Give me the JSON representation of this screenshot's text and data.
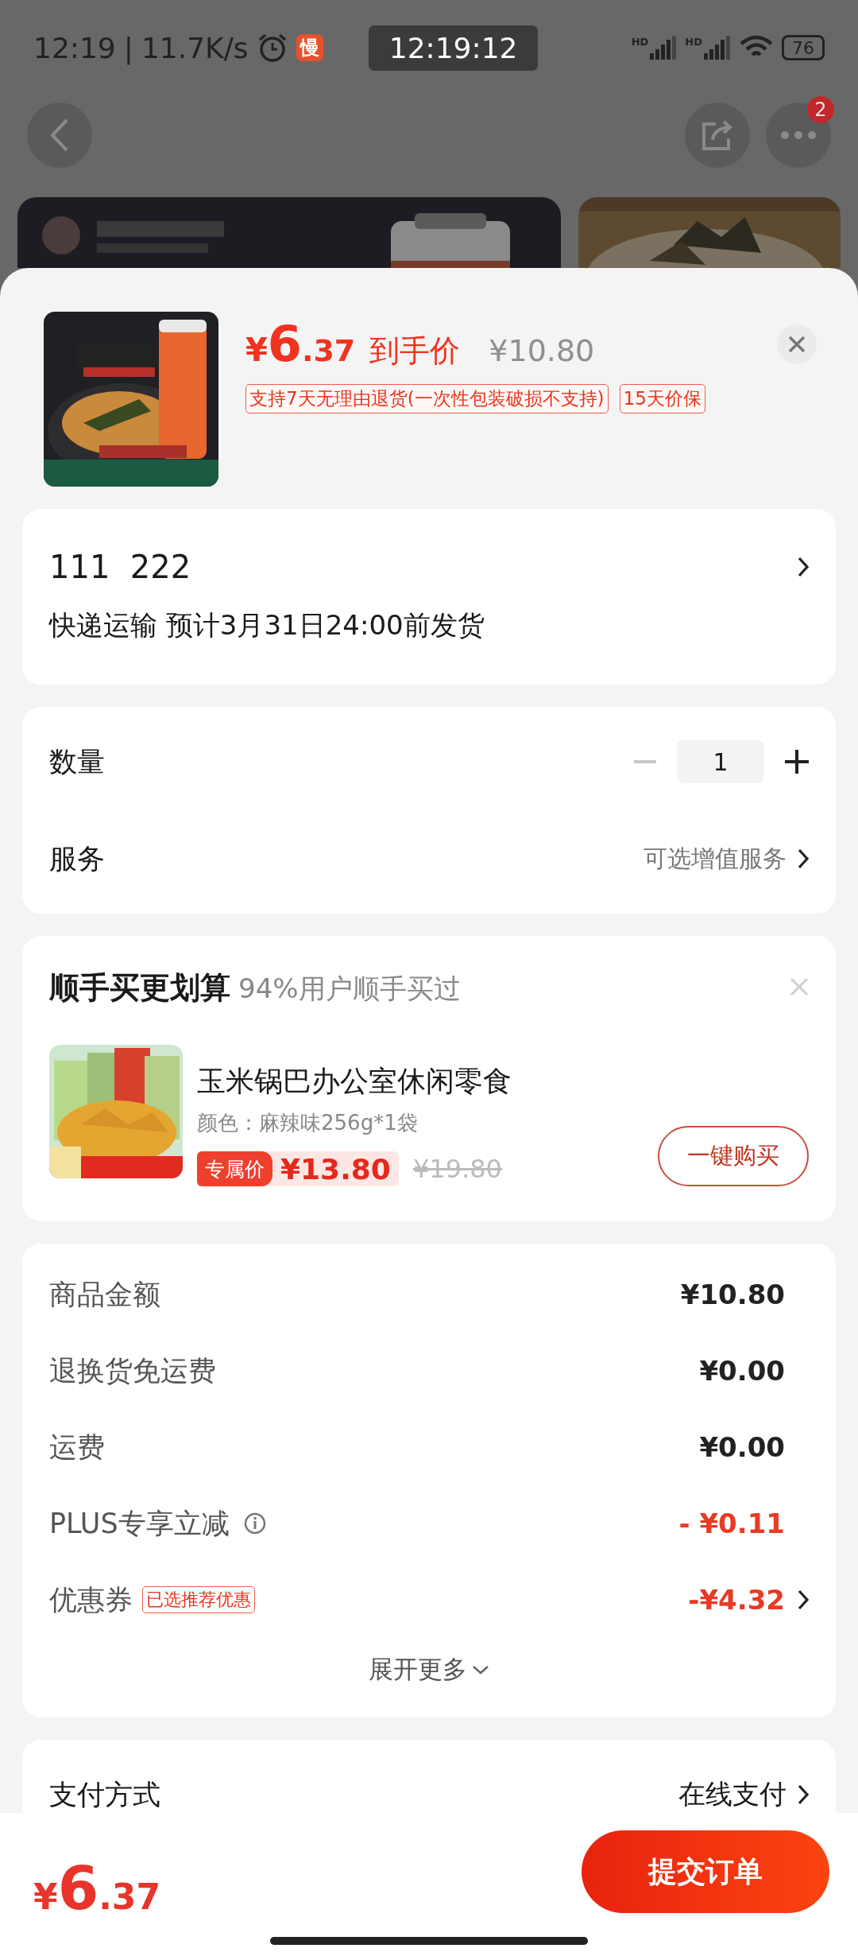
{
  "status_bar": {
    "time": "12:19",
    "separator": "|",
    "speed": "11.7K/s",
    "slow_badge": "慢",
    "clock_overlay": "12:19:12",
    "signals": [
      {
        "label": "HD"
      },
      {
        "label": "HD"
      }
    ],
    "battery": "76"
  },
  "nav": {
    "more_badge": "2"
  },
  "product": {
    "currency": "¥",
    "price_int": "6",
    "price_dec": ".37",
    "price_label": "到手价",
    "original_price": "¥10.80",
    "tags": [
      "支持7天无理由退货(一次性包装破损不支持)",
      "15天价保"
    ]
  },
  "address": {
    "name": "111  222",
    "shipping": "快递运输 预计3月31日24:00前发货"
  },
  "quantity": {
    "label": "数量",
    "value": "1",
    "decrease_disabled": true
  },
  "service": {
    "label": "服务",
    "value": "可选增值服务"
  },
  "bundle": {
    "title": "顺手买更划算",
    "subtitle": "94%用户顺手买过",
    "item": {
      "name": "玉米锅巴办公室休闲零食",
      "spec": "颜色：麻辣味256g*1袋",
      "price_tag": "专属价",
      "price": "¥13.80",
      "original_price": "¥19.80",
      "button": "一键购买"
    }
  },
  "summary": {
    "rows": [
      {
        "kind": "amount",
        "label": "商品金额",
        "value": "¥10.80"
      },
      {
        "kind": "amount",
        "label": "退换货免运费",
        "value": "¥0.00"
      },
      {
        "kind": "amount",
        "label": "运费",
        "value": "¥0.00"
      },
      {
        "kind": "discount",
        "label": "PLUS专享立减",
        "value": "- ¥0.11"
      },
      {
        "kind": "coupon",
        "label": "优惠券",
        "tag": "已选推荐优惠",
        "value": "-¥4.32"
      }
    ],
    "expand": "展开更多"
  },
  "payment": {
    "label": "支付方式",
    "value": "在线支付"
  },
  "footer": {
    "currency": "¥",
    "price_int": "6",
    "price_dec": ".37",
    "submit": "提交订单"
  }
}
